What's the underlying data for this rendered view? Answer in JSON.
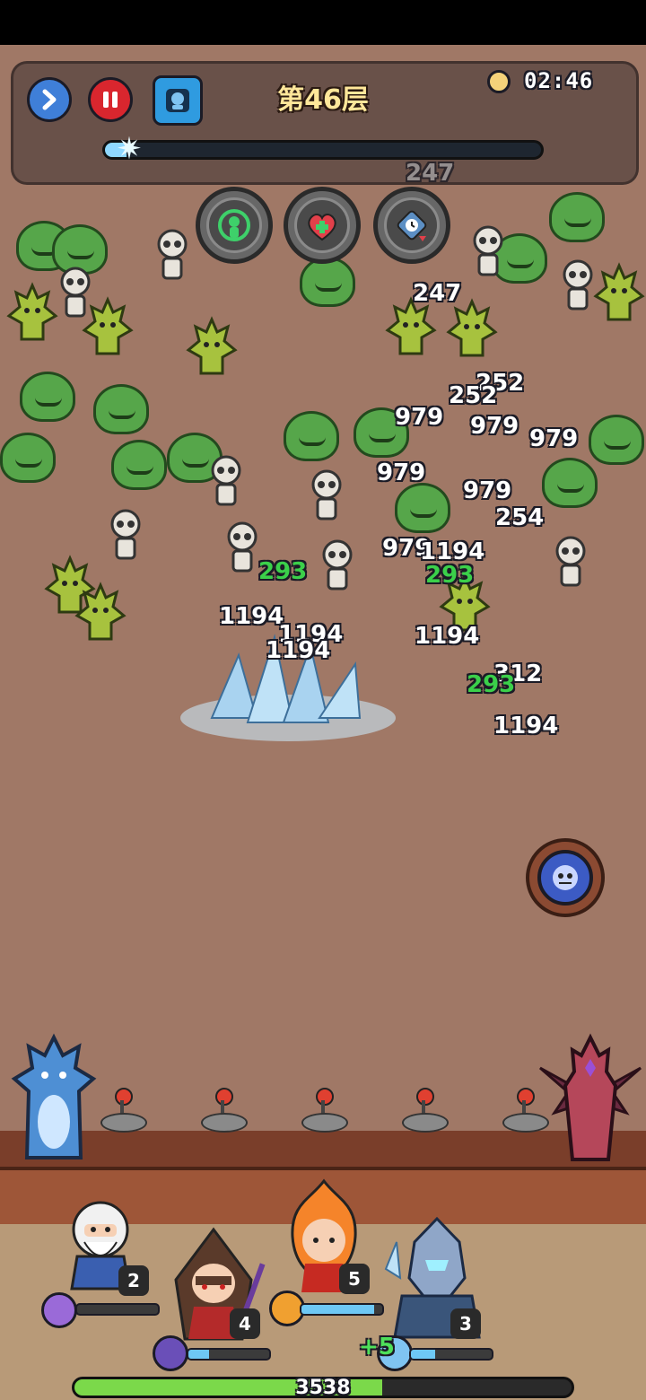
{
  "hud": {
    "floor_label": "第46层",
    "timer": "02:46",
    "wave_progress": 0.05
  },
  "skills": [
    {
      "icon": "green-target-icon"
    },
    {
      "icon": "heart-heal-icon"
    },
    {
      "icon": "clock-speed-icon"
    }
  ],
  "damage_numbers": [
    {
      "text": "247",
      "type": "damage"
    },
    {
      "text": "247",
      "type": "damage"
    },
    {
      "text": "252",
      "type": "damage"
    },
    {
      "text": "252",
      "type": "damage"
    },
    {
      "text": "979",
      "type": "damage"
    },
    {
      "text": "979",
      "type": "damage"
    },
    {
      "text": "979",
      "type": "damage"
    },
    {
      "text": "979",
      "type": "damage"
    },
    {
      "text": "979",
      "type": "damage"
    },
    {
      "text": "979",
      "type": "damage"
    },
    {
      "text": "254",
      "type": "damage"
    },
    {
      "text": "1194",
      "type": "damage"
    },
    {
      "text": "293",
      "type": "heal"
    },
    {
      "text": "293",
      "type": "heal"
    },
    {
      "text": "1194",
      "type": "damage"
    },
    {
      "text": "1194",
      "type": "damage"
    },
    {
      "text": "1194",
      "type": "damage"
    },
    {
      "text": "1194",
      "type": "damage"
    },
    {
      "text": "312",
      "type": "damage"
    },
    {
      "text": "293",
      "type": "heal"
    },
    {
      "text": "1194",
      "type": "damage"
    }
  ],
  "heroes": [
    {
      "name": "old-sage-hero",
      "level": "2",
      "charge": 0.0
    },
    {
      "name": "hooded-mage-hero",
      "level": "4",
      "charge": 0.25
    },
    {
      "name": "fire-spirit-hero",
      "level": "5",
      "charge": 0.9
    },
    {
      "name": "ice-knight-hero",
      "level": "3",
      "charge": 0.3
    }
  ],
  "bonus_text": "+5",
  "wall_hp": {
    "value": "3538",
    "fraction": 0.62
  },
  "colors": {
    "slime": "#56a64a",
    "heal_text": "#3bd04a",
    "hp_fill": "#7bd94a",
    "mana_fill": "#6ec8f5"
  }
}
